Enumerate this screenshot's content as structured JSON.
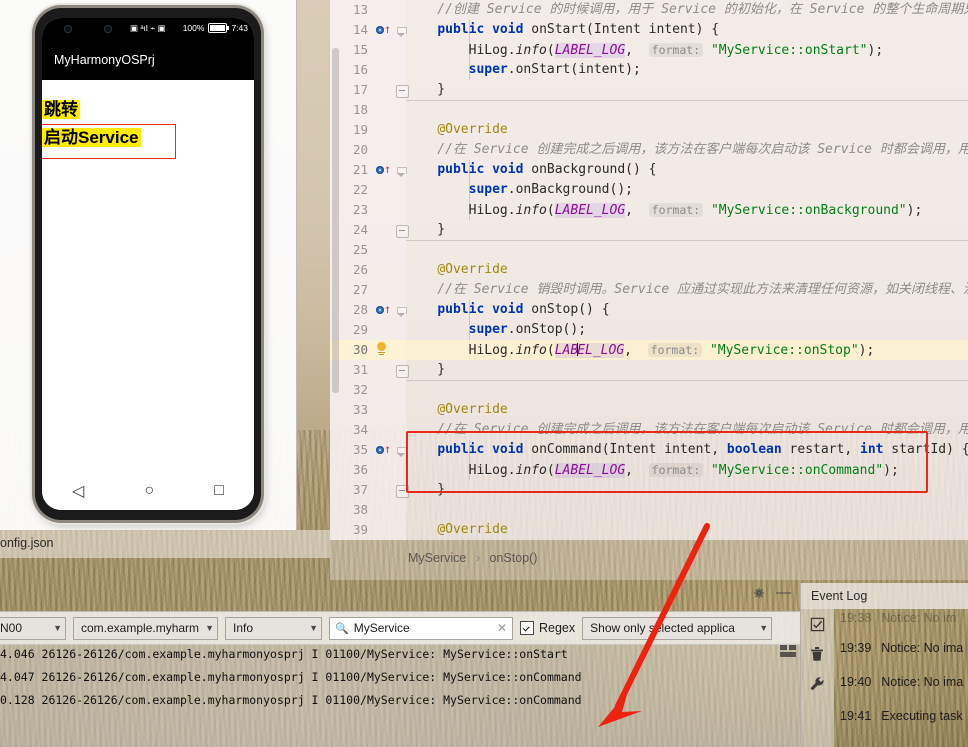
{
  "editor": {
    "breadcrumb": {
      "class_name": "MyService",
      "separator": "›",
      "method_name": "onStop()"
    },
    "tab_label": "onfig.json",
    "lines": [
      {
        "n": "13",
        "marker": "none",
        "fold": "none",
        "html": "<span class=\"cmt\">    //创建 Service 的时候调用，用于 Service 的初始化，在 Service 的整个生命周期只会调</span>"
      },
      {
        "n": "14",
        "marker": "override",
        "fold": "collapse-arrow",
        "html": "    <span class=\"kw\">public</span> <span class=\"kw\">void</span> onStart(Intent intent) {"
      },
      {
        "n": "15",
        "marker": "none",
        "fold": "none",
        "html": "        HiLog.<span class=\"meth\">info</span>(<span class=\"fld\">LABEL_LOG</span>,  <span class=\"hint\">format:</span> <span class=\"str\">\"MyService::onStart\"</span>);"
      },
      {
        "n": "16",
        "marker": "none",
        "fold": "none",
        "html": "        <span class=\"kw\">super</span>.onStart(intent);"
      },
      {
        "n": "17",
        "marker": "none",
        "fold": "minus",
        "html": "    }"
      },
      {
        "n": "18",
        "marker": "none",
        "fold": "none",
        "html": ""
      },
      {
        "n": "19",
        "marker": "none",
        "fold": "none",
        "html": "    <span class=\"ann\">@Override</span>"
      },
      {
        "n": "20",
        "marker": "none",
        "fold": "none",
        "html": "<span class=\"cmt\">    //在 Service 创建完成之后调用，该方法在客户端每次启动该 Service 时都会调用，用户</span>"
      },
      {
        "n": "21",
        "marker": "override",
        "fold": "collapse-arrow",
        "html": "    <span class=\"kw\">public</span> <span class=\"kw\">void</span> onBackground() {"
      },
      {
        "n": "22",
        "marker": "none",
        "fold": "none",
        "html": "        <span class=\"kw\">super</span>.onBackground();"
      },
      {
        "n": "23",
        "marker": "none",
        "fold": "none",
        "html": "        HiLog.<span class=\"meth\">info</span>(<span class=\"fld\">LABEL_LOG</span>,  <span class=\"hint\">format:</span> <span class=\"str\">\"MyService::onBackground\"</span>);"
      },
      {
        "n": "24",
        "marker": "none",
        "fold": "minus",
        "html": "    }"
      },
      {
        "n": "25",
        "marker": "none",
        "fold": "none",
        "html": ""
      },
      {
        "n": "26",
        "marker": "none",
        "fold": "none",
        "html": "    <span class=\"ann\">@Override</span>"
      },
      {
        "n": "27",
        "marker": "none",
        "fold": "none",
        "html": "<span class=\"cmt\">    //在 Service 销毁时调用。Service 应通过实现此方法来清理任何资源，如关闭线程、注册</span>"
      },
      {
        "n": "28",
        "marker": "override",
        "fold": "collapse-arrow",
        "html": "    <span class=\"kw\">public</span> <span class=\"kw\">void</span> onStop() {"
      },
      {
        "n": "29",
        "marker": "none",
        "fold": "none",
        "html": "        <span class=\"kw\">super</span>.onStop();"
      },
      {
        "n": "30",
        "marker": "bulb",
        "fold": "none",
        "highlight": true,
        "html": "        HiLog.<span class=\"meth\">info</span>(<span class=\"fld\">LAB<span class=\"caretbar\"></span>EL_LOG</span>,  <span class=\"hint\">format:</span> <span class=\"str\">\"MyService::onStop\"</span>);"
      },
      {
        "n": "31",
        "marker": "none",
        "fold": "minus",
        "html": "    }"
      },
      {
        "n": "32",
        "marker": "none",
        "fold": "none",
        "html": ""
      },
      {
        "n": "33",
        "marker": "none",
        "fold": "none",
        "html": "    <span class=\"ann\">@Override</span>"
      },
      {
        "n": "34",
        "marker": "none",
        "fold": "none",
        "html": "<span class=\"cmt\">    //在 Service 创建完成之后调用，该方法在客户端每次启动该 Service 时都会调用，用户</span>"
      },
      {
        "n": "35",
        "marker": "override",
        "fold": "collapse-arrow",
        "html": "    <span class=\"kw\">public</span> <span class=\"kw\">void</span> onCommand(Intent intent, <span class=\"kw\">boolean</span> restart, <span class=\"kw\">int</span> startId) {"
      },
      {
        "n": "36",
        "marker": "none",
        "fold": "none",
        "html": "        HiLog.<span class=\"meth\">info</span>(<span class=\"fld\">LABEL_LOG</span>,  <span class=\"hint\">format:</span> <span class=\"str\">\"MyService::onCommand\"</span>);"
      },
      {
        "n": "37",
        "marker": "none",
        "fold": "minus",
        "html": "    }"
      },
      {
        "n": "38",
        "marker": "none",
        "fold": "none",
        "html": ""
      },
      {
        "n": "39",
        "marker": "none",
        "fold": "none",
        "html": "    <span class=\"ann\">@Override</span>"
      }
    ]
  },
  "phone": {
    "status": {
      "signal_icons": "▣ ᵃıl ⌁ ▣",
      "battery_percent": "100%",
      "clock": "7:43"
    },
    "app_title": "MyHarmonyOSPrj",
    "buttons": [
      {
        "label": "跳转",
        "highlighted": true,
        "annotated": false
      },
      {
        "label": "启动Service",
        "highlighted": true,
        "annotated": true
      }
    ],
    "nav": {
      "back": "◁",
      "home": "○",
      "recents": "□"
    }
  },
  "logcat": {
    "device_combo": "N00",
    "process_combo": "com.example.myharmony‹",
    "level_combo": "Info",
    "search_value": "MyService",
    "search_icon_label": "search-icon",
    "regex_label": "Regex",
    "regex_checked": true,
    "scope_combo": "Show only selected applica",
    "rows": [
      "4.046 26126-26126/com.example.myharmonyosprj I 01100/MyService: MyService::onStart",
      "4.047 26126-26126/com.example.myharmonyosprj I 01100/MyService: MyService::onCommand",
      "0.128 26126-26126/com.example.myharmonyosprj I 01100/MyService: MyService::onCommand"
    ]
  },
  "event_log": {
    "title": "Event Log",
    "gutter_icons": [
      "checkbox-icon",
      "trash-icon",
      "wrench-icon"
    ],
    "entries": [
      {
        "time": "19:38",
        "text": "Notice: No im",
        "faded": true
      },
      {
        "time": "19:39",
        "text": "Notice: No ima",
        "faded": false
      },
      {
        "time": "19:40",
        "text": "Notice: No ima",
        "faded": false
      },
      {
        "time": "19:41",
        "text": "Executing task",
        "faded": false
      }
    ]
  },
  "annotations": {
    "arrow_color": "#ee2211",
    "box_color": "#e8291c"
  }
}
